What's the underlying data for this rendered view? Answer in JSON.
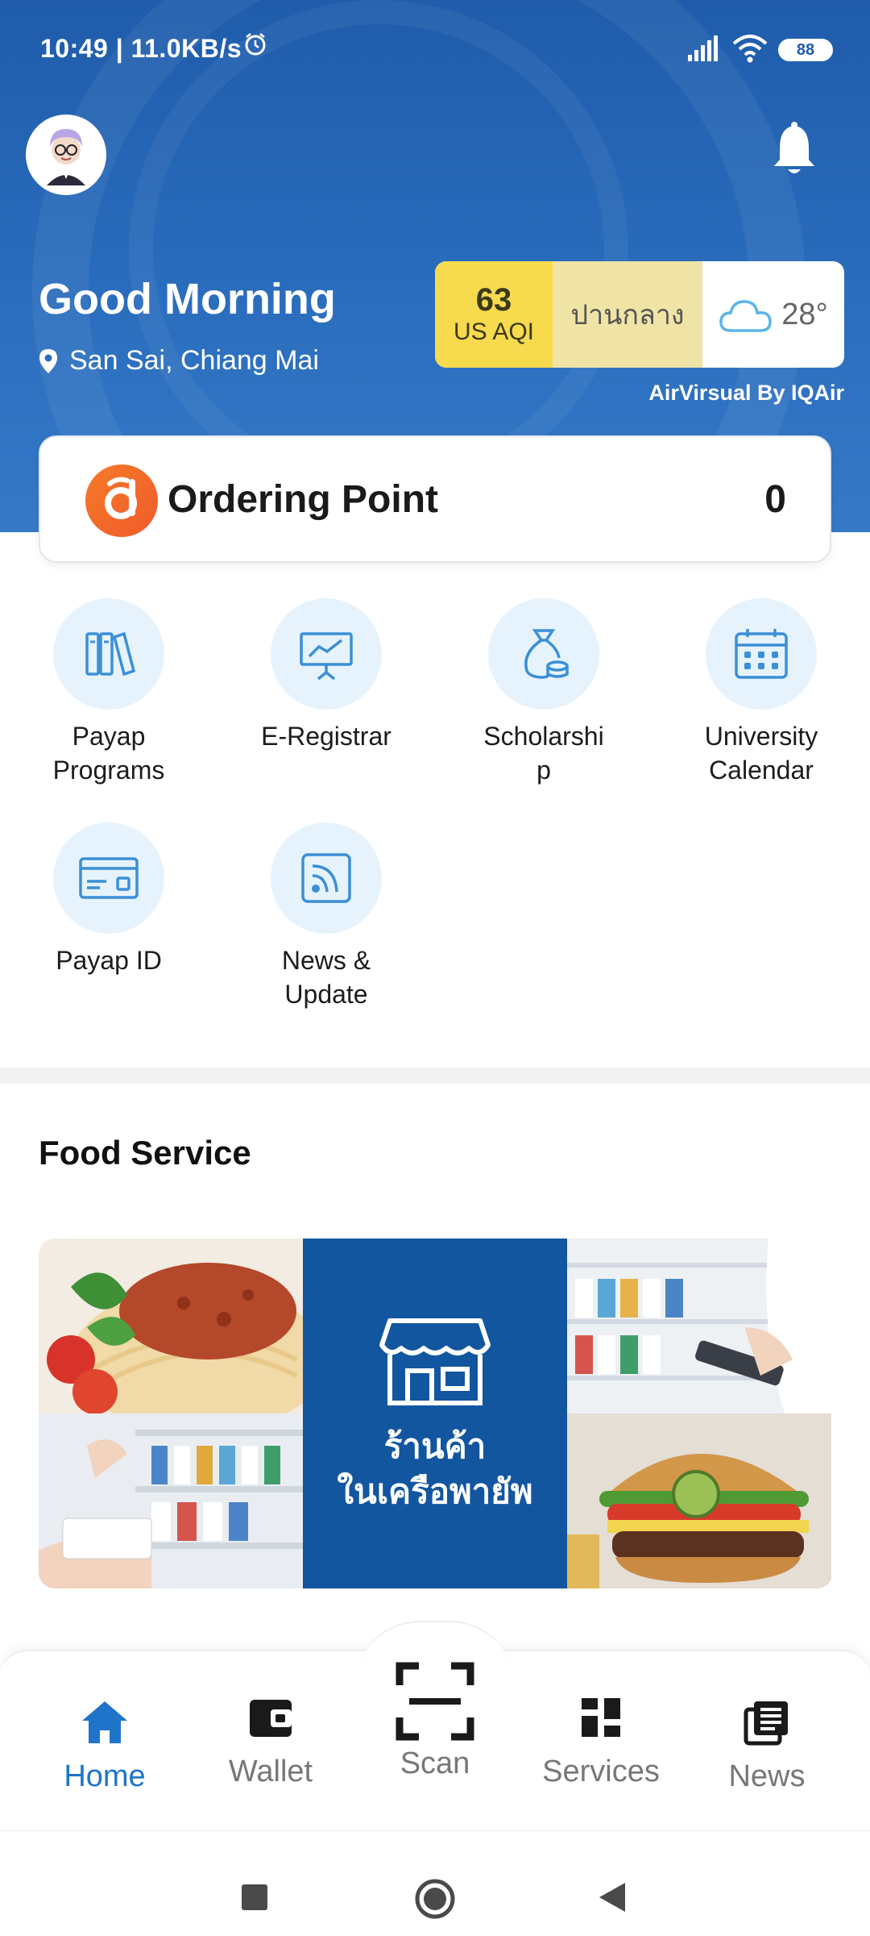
{
  "status_bar": {
    "time": "10:49 | 11.0KB/s",
    "battery": "88",
    "icons": [
      "alarm-icon",
      "signal-icon",
      "wifi-icon",
      "battery-icon"
    ]
  },
  "header": {
    "greeting": "Good Morning",
    "location": "San Sai, Chiang Mai",
    "icons": [
      "avatar",
      "bell-icon",
      "location-pin-icon"
    ]
  },
  "aqi": {
    "value": "63",
    "unit": "US AQI",
    "place": "ปานกลาง",
    "temperature": "28°",
    "credit": "AirVirsual By IQAir",
    "color_aqi": "#f7da4d",
    "color_place": "#efe4a6"
  },
  "ordering_point": {
    "label": "Ordering Point",
    "value": "0"
  },
  "menu": [
    {
      "label": "Payap\nPrograms",
      "icon": "books-icon"
    },
    {
      "label": "E-Registrar",
      "icon": "presentation-chart-icon"
    },
    {
      "label": "Scholarshi\np",
      "icon": "money-bag-icon"
    },
    {
      "label": "University\nCalendar",
      "icon": "calendar-icon"
    },
    {
      "label": "Payap ID",
      "icon": "id-card-icon"
    },
    {
      "label": "News &\nUpdate",
      "icon": "rss-icon"
    }
  ],
  "food_service": {
    "title": "Food Service",
    "banner_line1": "ร้านค้า",
    "banner_line2": "ในเครือพายัพ"
  },
  "tabs": [
    {
      "label": "Home",
      "icon": "home-icon",
      "active": true
    },
    {
      "label": "Wallet",
      "icon": "wallet-icon",
      "active": false
    },
    {
      "label": "Scan",
      "icon": "scan-icon",
      "active": false
    },
    {
      "label": "Services",
      "icon": "grid-icon",
      "active": false
    },
    {
      "label": "News",
      "icon": "news-icon",
      "active": false
    }
  ],
  "colors": {
    "primary_blue": "#1f5cab",
    "active_tab": "#1f74c9",
    "icon_blue": "#3b8fd6",
    "icon_bg": "#e6f3fd",
    "banner_blue": "#1356a0",
    "point_orange": "#f05a2a"
  }
}
